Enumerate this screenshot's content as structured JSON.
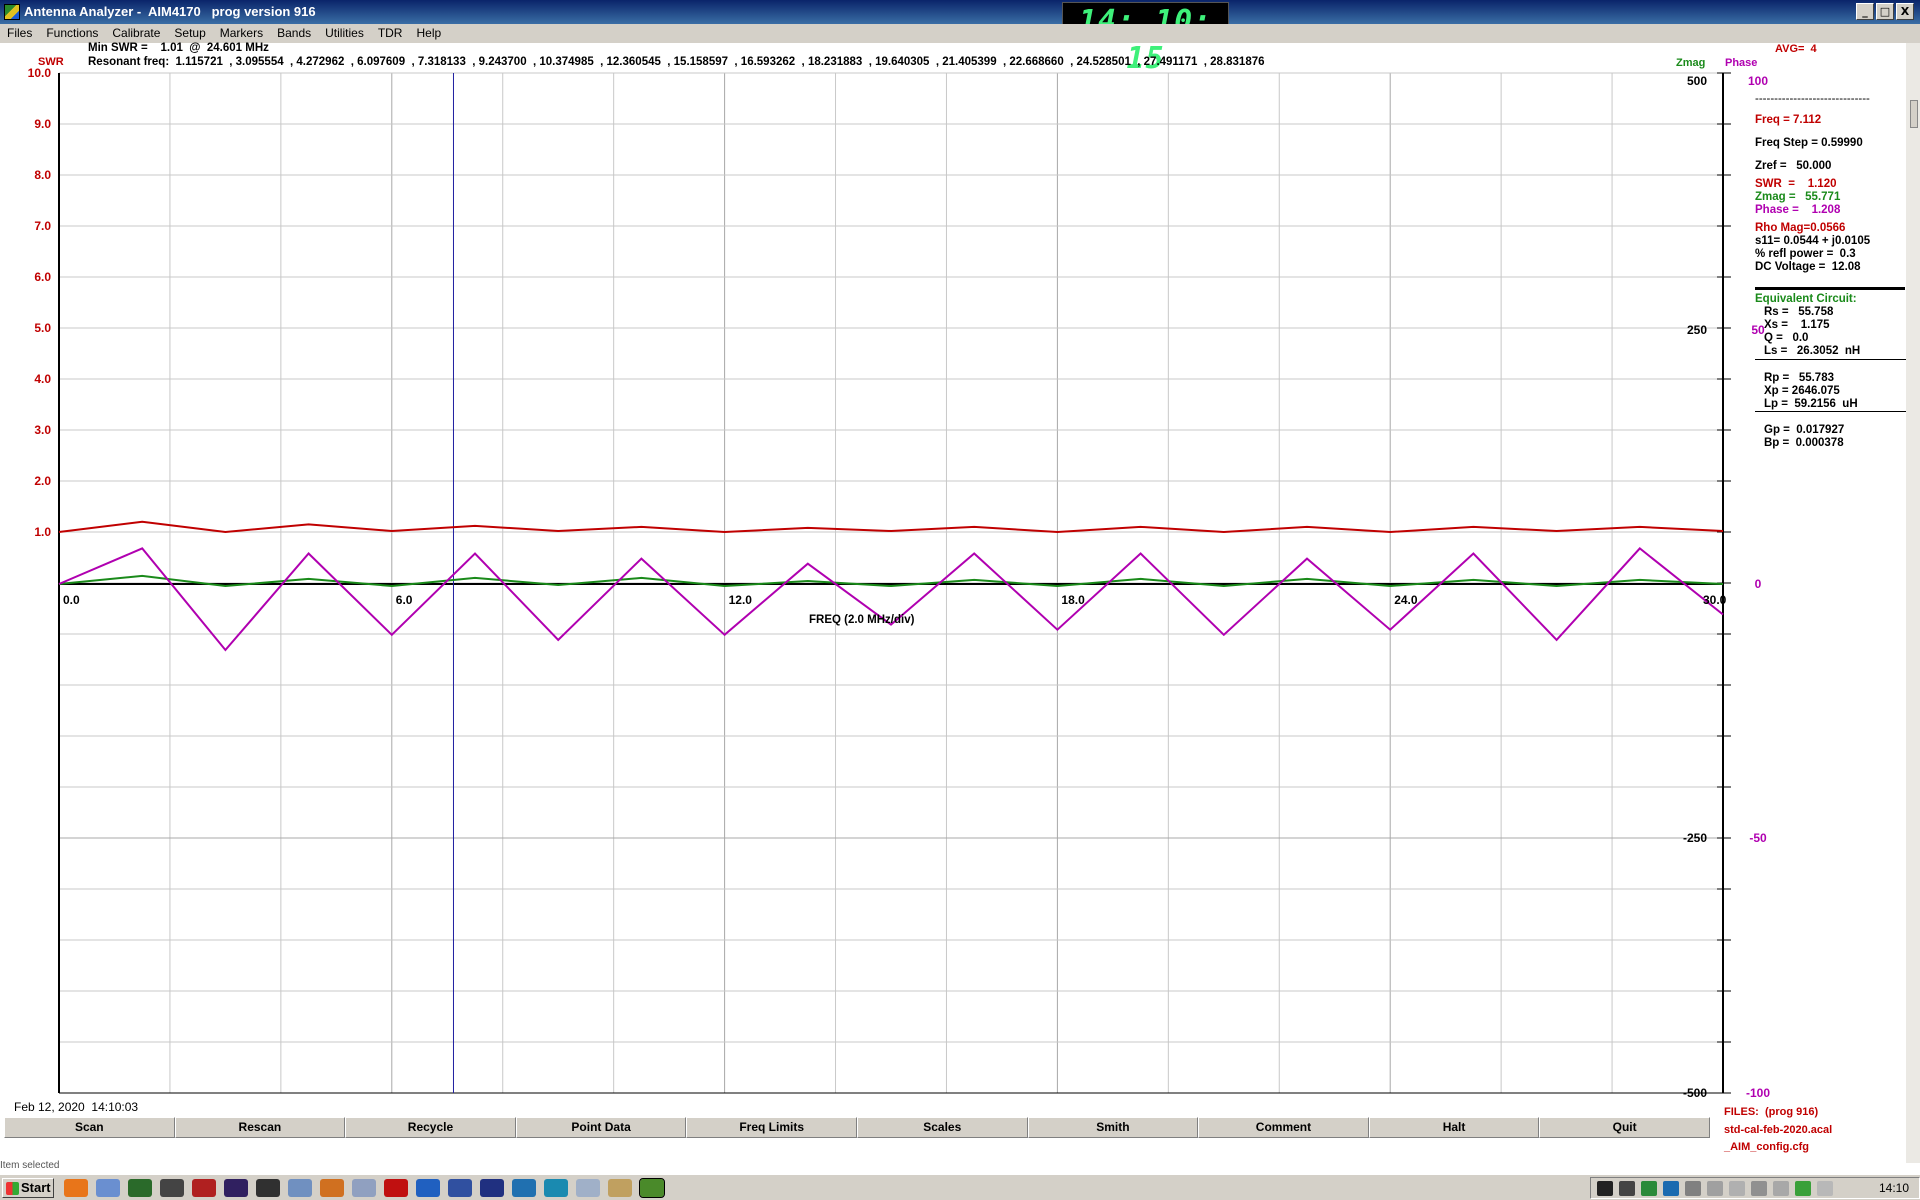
{
  "window": {
    "title": "Antenna Analyzer -  AIM4170   prog version 916",
    "btn_min": "_",
    "btn_max": "□",
    "btn_close": "X",
    "clock": "14: 10: 15"
  },
  "menu": [
    "Files",
    "Functions",
    "Calibrate",
    "Setup",
    "Markers",
    "Bands",
    "Utilities",
    "TDR",
    "Help"
  ],
  "header": {
    "min_swr": "Min SWR =    1.01  @  24.601 MHz",
    "resonant": "Resonant freq:  1.115721  , 3.095554  , 4.272962  , 6.097609  , 7.318133  , 9.243700  , 10.374985  , 12.360545  , 15.158597  , 16.593262  , 18.231883  , 19.640305  , 21.405399  , 22.668660  , 24.528501  , 27.491171  , 28.831876",
    "swr_label": "SWR",
    "zmag_label": "Zmag",
    "phase_label": "Phase",
    "avg": "AVG=  4"
  },
  "axes": {
    "swr_ticks": [
      "10.0",
      "9.0",
      "8.0",
      "7.0",
      "6.0",
      "5.0",
      "4.0",
      "3.0",
      "2.0",
      "1.0"
    ],
    "freq_ticks": [
      "0.0",
      "6.0",
      "12.0",
      "18.0",
      "24.0",
      "30.0"
    ],
    "freq_label": "FREQ (2.0 MHz/div)",
    "zmag_ticks": [
      "500",
      "250",
      "-250",
      "-500"
    ],
    "phase_ticks": [
      "100",
      "50",
      "0",
      "-50",
      "-100"
    ]
  },
  "panel": {
    "dashes": "------------------------------",
    "freq": "Freq = 7.112",
    "freq_step": "Freq Step = 0.59990",
    "zref": "Zref =   50.000",
    "swr": "SWR  =    1.120",
    "zmag": "Zmag =   55.771",
    "phase": "Phase =    1.208",
    "rho": "Rho Mag=0.0566",
    "s11": "s11= 0.0544 + j0.0105",
    "refl": "% refl power =  0.3",
    "dc": "DC Voltage =  12.08",
    "eq_title": "Equivalent Circuit:",
    "rs": "Rs =   55.758",
    "xs": "Xs =    1.175",
    "q": "Q =   0.0",
    "ls": "Ls =   26.3052  nH",
    "rp": "Rp =   55.783",
    "xp": "Xp = 2646.075",
    "lp": "Lp =  59.2156  uH",
    "gp": "Gp =  0.017927",
    "bp": "Bp =  0.000378",
    "files_title": "FILES:  (prog 916)",
    "file1": "std-cal-feb-2020.acal",
    "file2": "_AIM_config.cfg"
  },
  "timestamp": "Feb 12, 2020  14:10:03",
  "buttons": [
    "Scan",
    "Rescan",
    "Recycle",
    "Point Data",
    "Freq Limits",
    "Scales",
    "Smith",
    "Comment",
    "Halt",
    "Quit"
  ],
  "statusbar": "Item selected",
  "taskbar": {
    "start": "Start",
    "clock": "14:10"
  },
  "colors": {
    "swr_trace": "#c00000",
    "zmag_trace": "#1a8a1a",
    "phase_trace": "#b000b0",
    "marker": "#2020a0",
    "grid": "#c8c8c8"
  },
  "chart_data": {
    "type": "line",
    "xlabel": "FREQ (2.0 MHz/div)",
    "xlim": [
      0,
      30
    ],
    "swr_ylim": [
      1,
      10
    ],
    "zmag_ylim": [
      -500,
      500
    ],
    "phase_ylim": [
      -100,
      100
    ],
    "marker_freq": 7.112,
    "x": [
      0,
      1.5,
      3,
      4.5,
      6,
      7.5,
      9,
      10.5,
      12,
      13.5,
      15,
      16.5,
      18,
      19.5,
      21,
      22.5,
      24,
      25.5,
      27,
      28.5,
      30
    ],
    "series": [
      {
        "name": "SWR",
        "values": [
          1.0,
          1.2,
          1.0,
          1.15,
          1.02,
          1.12,
          1.02,
          1.1,
          1.0,
          1.08,
          1.02,
          1.1,
          1.0,
          1.1,
          1.0,
          1.1,
          1.0,
          1.1,
          1.02,
          1.1,
          1.02
        ]
      },
      {
        "name": "Zmag",
        "values": [
          50,
          58,
          48,
          55,
          48,
          56,
          49,
          56,
          48,
          53,
          48,
          54,
          48,
          55,
          48,
          55,
          48,
          54,
          48,
          54,
          50
        ]
      },
      {
        "name": "Phase",
        "values": [
          0,
          7,
          -13,
          6,
          -10,
          6,
          -11,
          5,
          -10,
          4,
          -8,
          6,
          -9,
          6,
          -10,
          5,
          -9,
          6,
          -11,
          7,
          -6
        ]
      }
    ]
  }
}
